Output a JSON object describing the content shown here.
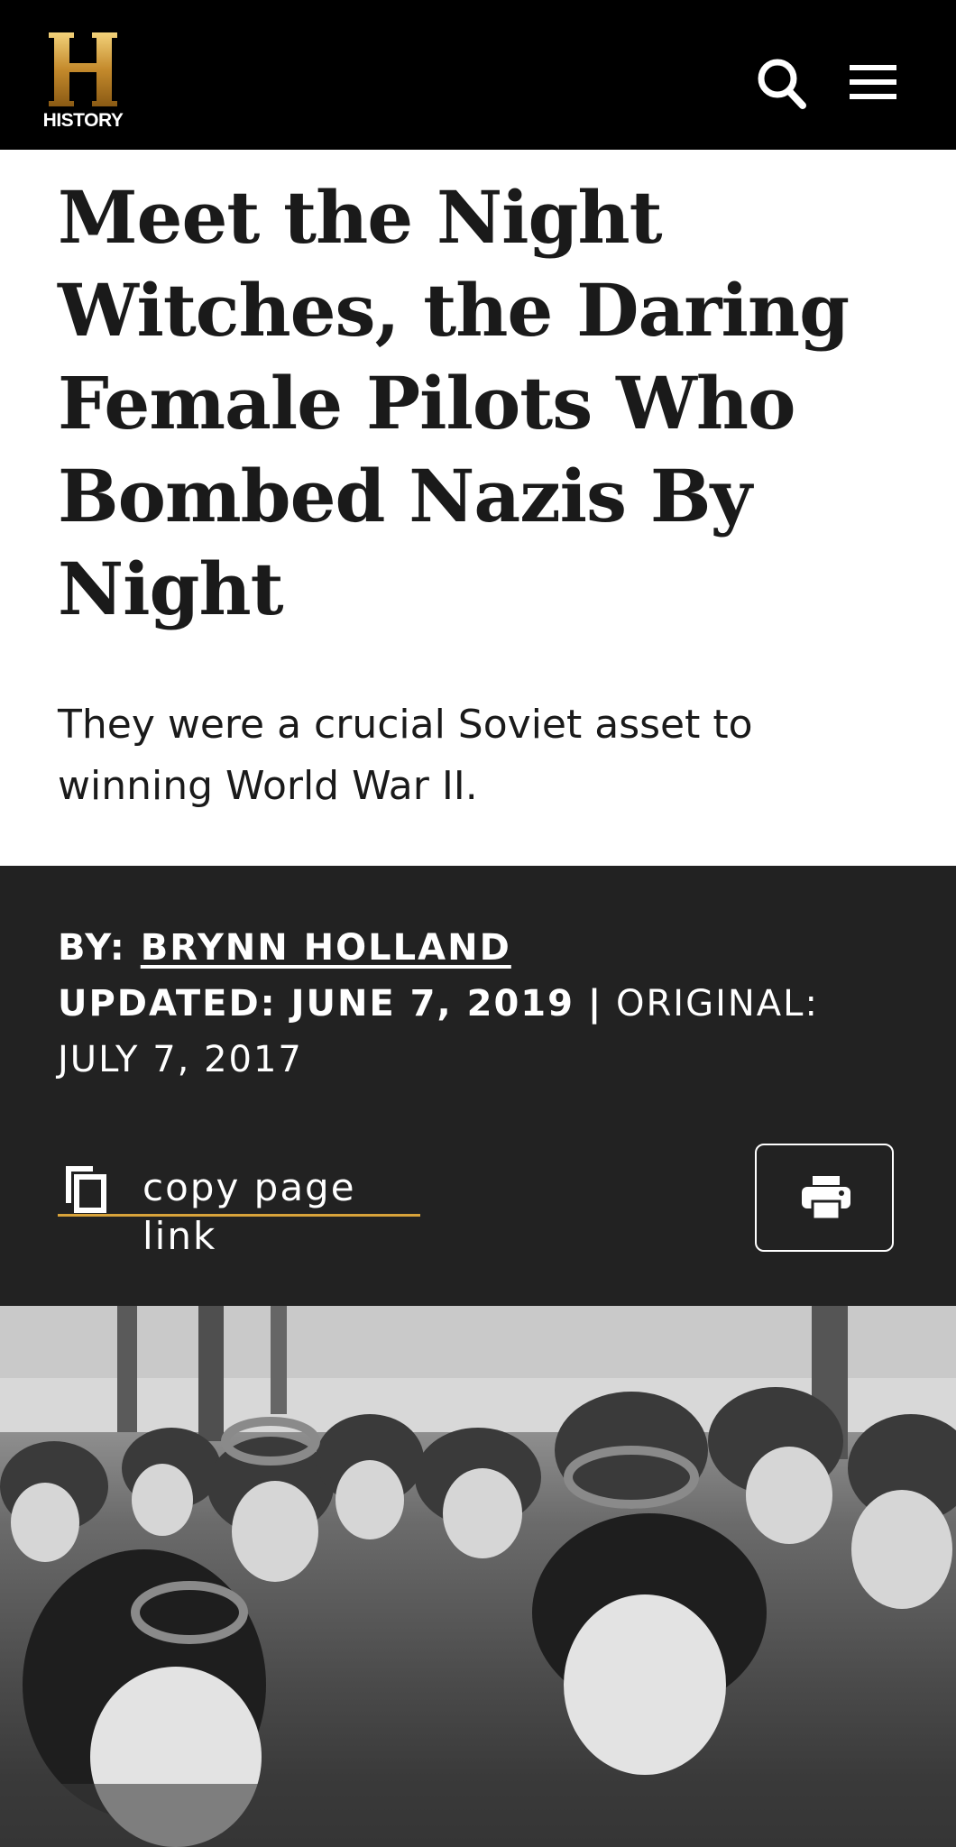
{
  "header": {
    "logo_text": "HISTORY",
    "search_icon": "search-icon",
    "menu_icon": "hamburger-menu-icon"
  },
  "article": {
    "title": "Meet the Night Witches, the Daring Female Pilots Who Bombed Nazis By Night",
    "dek": "They were a crucial Soviet asset to winning World War II.",
    "by_label": "BY:",
    "author": "BRYNN HOLLAND",
    "updated": "UPDATED: JUNE 7, 2019",
    "separator": "|",
    "original": "ORIGINAL: JULY 7, 2017",
    "copy_link_label": "copy page link",
    "copy_icon": "copy-icon",
    "print_icon": "print-icon"
  },
  "colors": {
    "header_bg": "#000000",
    "meta_bg": "#222222",
    "accent_gold": "#d8a33a",
    "text_dark": "#1a1a1a"
  }
}
